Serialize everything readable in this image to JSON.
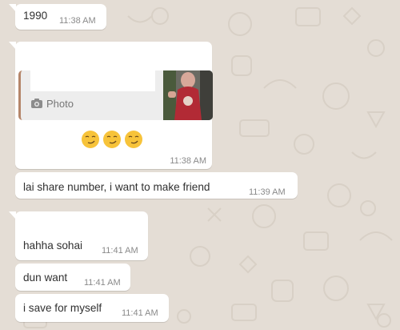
{
  "messages": [
    {
      "text": "1990",
      "time": "11:38 AM"
    },
    {
      "quote_label": "Photo",
      "emoji": "😏😏😏",
      "time": "11:38 AM"
    },
    {
      "text": "lai share number, i want to make friend",
      "time": "11:39 AM"
    },
    {
      "text": "hahha sohai",
      "time": "11:41 AM"
    },
    {
      "text": "dun want",
      "time": "11:41 AM"
    },
    {
      "text": "i save for myself",
      "time": "11:41 AM"
    }
  ],
  "icons": {
    "quote_icon": "camera-icon",
    "emoji_icon": "smirking-face-icon"
  },
  "colors": {
    "background": "#e4ddd5",
    "bubble": "#ffffff",
    "quote_bar": "#b5866a",
    "time": "#8a8a8a"
  }
}
